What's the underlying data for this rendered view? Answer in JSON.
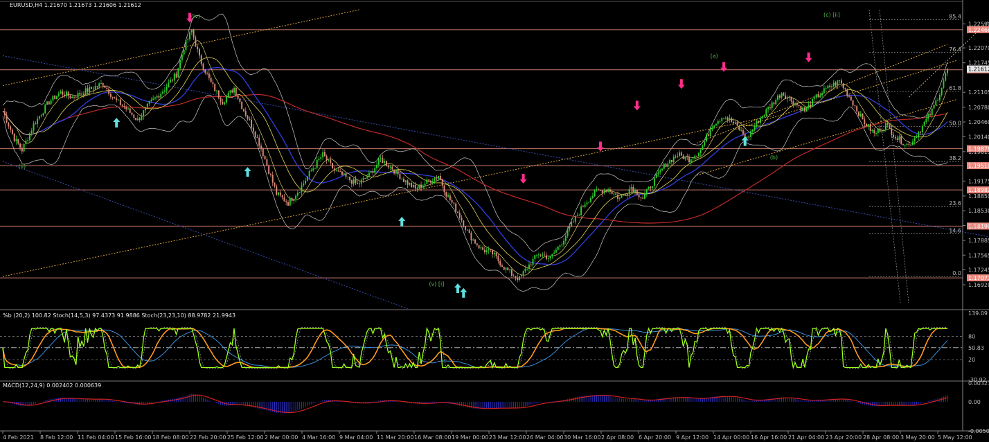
{
  "chart_data": {
    "type": "candlestick",
    "header": {
      "symbol_line": "EURUSD,H4  1.21670 1.21673 1.21606 1.21612"
    },
    "price_axis": {
      "ylim": [
        1.1653,
        1.229
      ],
      "ticks": [
        "1.22590",
        "1.22070",
        "1.21745",
        "1.21105",
        "1.20780",
        "1.20460",
        "1.20140",
        "1.19815",
        "1.19175",
        "1.18850",
        "1.18530",
        "1.18210",
        "1.17885",
        "1.17565",
        "1.17245",
        "1.16920"
      ],
      "tick_values": [
        1.2259,
        1.2207,
        1.21745,
        1.21105,
        1.2078,
        1.2046,
        1.2014,
        1.19815,
        1.19175,
        1.1885,
        1.1853,
        1.1821,
        1.17885,
        1.17565,
        1.17245,
        1.1692
      ]
    },
    "time_axis": {
      "labels": [
        "4 Feb 2021",
        "8 Feb 12:00",
        "11 Feb 04:00",
        "15 Feb 16:00",
        "18 Feb 08:00",
        "22 Feb 20:00",
        "25 Feb 12:00",
        "2 Mar 00:00",
        "4 Mar 16:00",
        "9 Mar 04:00",
        "11 Mar 20:00",
        "16 Mar 08:00",
        "19 Mar 00:00",
        "23 Mar 12:00",
        "26 Mar 04:00",
        "30 Mar 16:00",
        "2 Apr 08:00",
        "6 Apr 20:00",
        "9 Apr 12:00",
        "14 Apr 00:00",
        "16 Apr 16:00",
        "21 Apr 04:00",
        "23 Apr 20:00",
        "28 Apr 08:00",
        "3 May 20:00",
        "5 May 12:00"
      ]
    },
    "horizontal_levels": [
      {
        "label": "1.22466",
        "value": 1.22466
      },
      {
        "label": "1.21593",
        "value": 1.21593
      },
      {
        "label": "1.19878",
        "value": 1.19878
      },
      {
        "label": "1.19510",
        "value": 1.1951
      },
      {
        "label": "1.18982",
        "value": 1.18982
      },
      {
        "label": "1.18196",
        "value": 1.18196
      },
      {
        "label": "1.17071",
        "value": 1.17071
      }
    ],
    "current_price": {
      "label": "1.21612",
      "value": 1.21612
    },
    "fibonacci": [
      {
        "label": "85.4",
        "value": 1.2268
      },
      {
        "label": "76.4",
        "value": 1.2197
      },
      {
        "label": "61.8",
        "value": 1.2112
      },
      {
        "label": "50.0",
        "value": 1.2036
      },
      {
        "label": "38.2",
        "value": 1.196
      },
      {
        "label": "23.6",
        "value": 1.1862
      },
      {
        "label": "14.6",
        "value": 1.1803
      },
      {
        "label": "0.0",
        "value": 1.171
      }
    ],
    "wave_labels": [
      "(iv)",
      "(ii)",
      "(v) [i]",
      "(a)",
      "(b)",
      "(c) [ii]"
    ],
    "close_path": [
      [
        0,
        1.207
      ],
      [
        6,
        1.201
      ],
      [
        10,
        1.1985
      ],
      [
        16,
        1.204
      ],
      [
        24,
        1.209
      ],
      [
        30,
        1.211
      ],
      [
        36,
        1.21
      ],
      [
        44,
        1.2115
      ],
      [
        52,
        1.213
      ],
      [
        58,
        1.2095
      ],
      [
        64,
        1.2075
      ],
      [
        70,
        1.205
      ],
      [
        76,
        1.2085
      ],
      [
        84,
        1.2118
      ],
      [
        90,
        1.215
      ],
      [
        94,
        1.2208
      ],
      [
        98,
        1.2245
      ],
      [
        102,
        1.2185
      ],
      [
        108,
        1.213
      ],
      [
        114,
        1.209
      ],
      [
        120,
        1.212
      ],
      [
        124,
        1.208
      ],
      [
        130,
        1.203
      ],
      [
        134,
        1.199
      ],
      [
        138,
        1.194
      ],
      [
        142,
        1.189
      ],
      [
        148,
        1.187
      ],
      [
        154,
        1.19
      ],
      [
        160,
        1.194
      ],
      [
        166,
        1.1975
      ],
      [
        172,
        1.194
      ],
      [
        178,
        1.1925
      ],
      [
        184,
        1.191
      ],
      [
        190,
        1.193
      ],
      [
        196,
        1.1965
      ],
      [
        202,
        1.1945
      ],
      [
        208,
        1.192
      ],
      [
        214,
        1.19
      ],
      [
        220,
        1.1915
      ],
      [
        226,
        1.193
      ],
      [
        230,
        1.189
      ],
      [
        236,
        1.185
      ],
      [
        242,
        1.18
      ],
      [
        248,
        1.177
      ],
      [
        254,
        1.176
      ],
      [
        260,
        1.173
      ],
      [
        264,
        1.1715
      ],
      [
        268,
        1.1705
      ],
      [
        272,
        1.173
      ],
      [
        278,
        1.176
      ],
      [
        284,
        1.175
      ],
      [
        290,
        1.1785
      ],
      [
        296,
        1.183
      ],
      [
        302,
        1.187
      ],
      [
        308,
        1.1895
      ],
      [
        314,
        1.19
      ],
      [
        320,
        1.188
      ],
      [
        326,
        1.1905
      ],
      [
        332,
        1.188
      ],
      [
        338,
        1.192
      ],
      [
        344,
        1.1955
      ],
      [
        350,
        1.1975
      ],
      [
        356,
        1.1965
      ],
      [
        362,
        1.1985
      ],
      [
        368,
        1.204
      ],
      [
        374,
        1.206
      ],
      [
        380,
        1.204
      ],
      [
        386,
        1.201
      ],
      [
        392,
        1.205
      ],
      [
        398,
        1.208
      ],
      [
        404,
        1.211
      ],
      [
        410,
        1.209
      ],
      [
        416,
        1.207
      ],
      [
        422,
        1.21
      ],
      [
        428,
        1.212
      ],
      [
        434,
        1.2135
      ],
      [
        440,
        1.2095
      ],
      [
        446,
        1.205
      ],
      [
        452,
        1.202
      ],
      [
        458,
        1.204
      ],
      [
        464,
        1.201
      ],
      [
        470,
        1.1995
      ],
      [
        476,
        1.203
      ],
      [
        482,
        1.207
      ],
      [
        486,
        1.211
      ],
      [
        490,
        1.2161
      ]
    ],
    "bars_total": 490,
    "oscillator": {
      "title": "%b (20,2) 100.82  Stoch(14,5,3) 97.4373 91.9886  Stoch(23,23,10) 88.9782 21.9943",
      "axis_labels": [
        "139.09",
        "80",
        "50.83",
        "20",
        "-30.92"
      ],
      "axis_values": [
        139.09,
        80,
        50.83,
        20,
        -30.92
      ],
      "ylim": [
        -30.92,
        139.09
      ]
    },
    "macd": {
      "title": "MACD(12,24,9) 0.002402 0.000639",
      "axis_labels": [
        "0.003235",
        "0.00",
        "-0.005061"
      ],
      "axis_values": [
        0.003235,
        0.0,
        -0.005061
      ],
      "ylim": [
        -0.005061,
        0.003235
      ]
    },
    "colors": {
      "background": "#000000",
      "bull_candle": "#2ecc2e",
      "bear_candle": "#d98a78",
      "level_line": "#c97a6a",
      "level_label_bg": "#f08a80",
      "ma_blue": "#2f3bd4",
      "ma_red": "#c22a2a",
      "ma_yellow": "#cfc34a",
      "bollinger": "#b4b4b4",
      "channel_orange": "#d8a23a",
      "channel_blue": "#3a4fb0",
      "arrow_pink": "#ff2d8c",
      "arrow_cyan": "#5fe0e0",
      "stoch_green": "#9cff1e",
      "stoch_orange": "#ff9a1e",
      "macd_hist": "#3030c8",
      "macd_signal": "#d02020"
    }
  }
}
